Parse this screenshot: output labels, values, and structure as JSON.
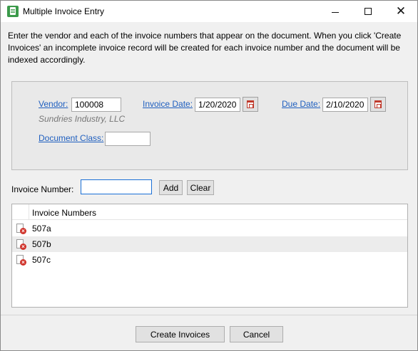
{
  "window": {
    "title": "Multiple Invoice Entry",
    "icon": "invoice-app-icon"
  },
  "instructions": "Enter the vendor and each of the invoice numbers that appear on the document. When you click 'Create Invoices' an incomplete invoice record will be created for each invoice number and the document will be indexed accordingly.",
  "form": {
    "vendor_label": "Vendor:",
    "vendor_value": "100008",
    "vendor_name": "Sundries Industry, LLC",
    "invoice_date_label": "Invoice Date:",
    "invoice_date_value": "1/20/2020",
    "due_date_label": "Due Date:",
    "due_date_value": "2/10/2020",
    "document_class_label": "Document Class:",
    "document_class_value": ""
  },
  "invoice_entry": {
    "label": "Invoice Number:",
    "value": "",
    "add_label": "Add",
    "clear_label": "Clear"
  },
  "list": {
    "header": "Invoice Numbers",
    "rows": [
      "507a",
      "507b",
      "507c"
    ]
  },
  "footer": {
    "create_label": "Create Invoices",
    "cancel_label": "Cancel"
  },
  "colors": {
    "link": "#1f5fbf",
    "focus_border": "#1a6fd6",
    "error": "#d0332b"
  }
}
